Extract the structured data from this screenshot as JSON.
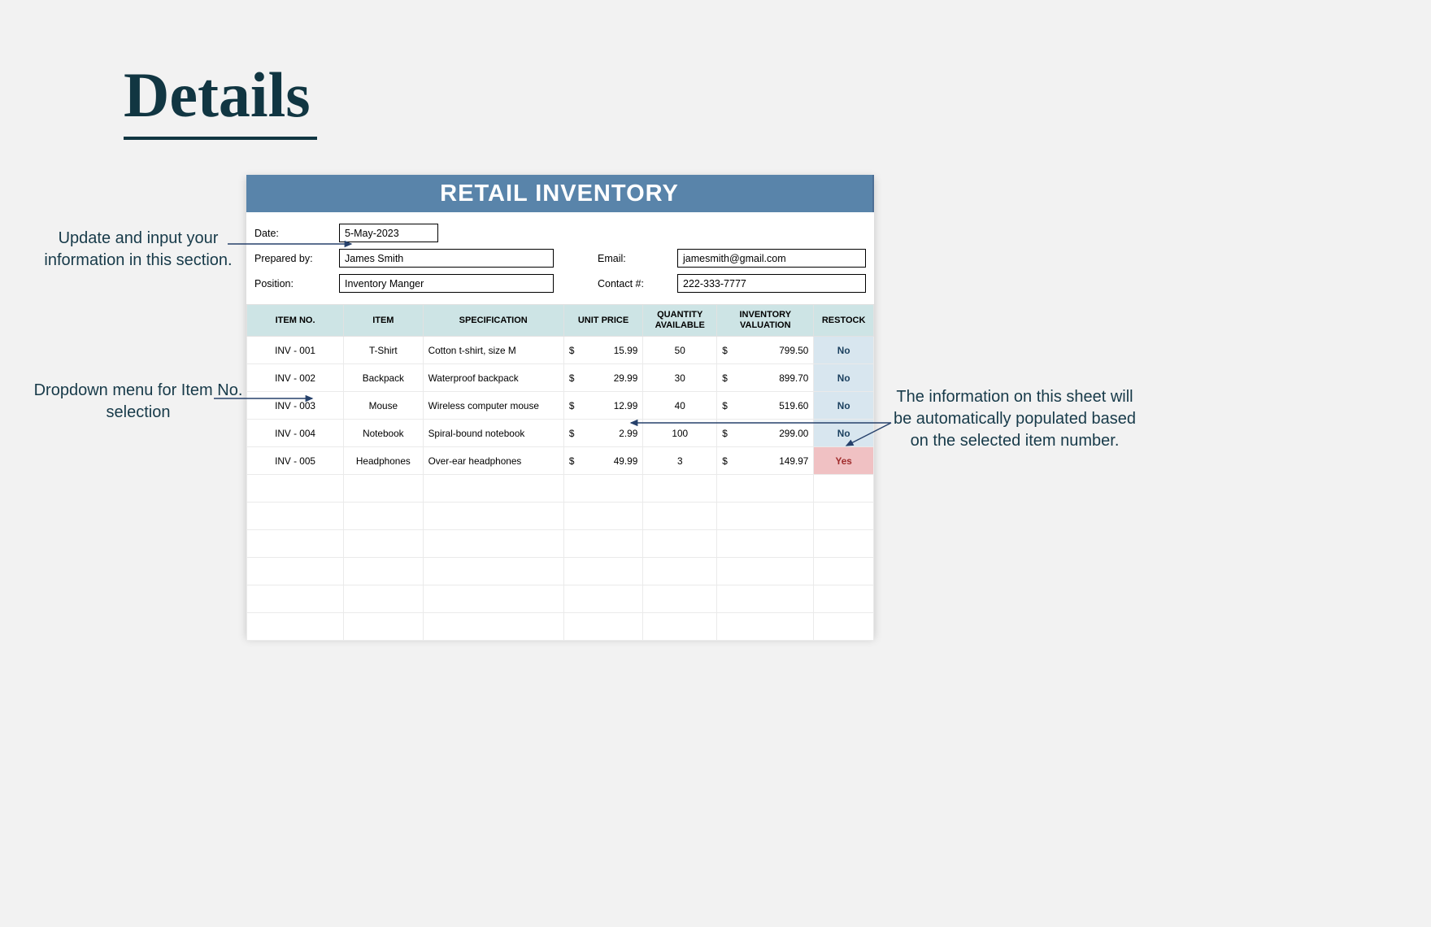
{
  "page": {
    "title": "Details"
  },
  "annotations": {
    "left1": "Update and input your information in this section.",
    "left2": "Dropdown menu for Item No. selection",
    "right": "The information on this sheet will be automatically populated based on the selected item number."
  },
  "sheet": {
    "title": "RETAIL INVENTORY"
  },
  "info": {
    "labels": {
      "date": "Date:",
      "prepared": "Prepared by:",
      "position": "Position:",
      "email": "Email:",
      "contact": "Contact #:"
    },
    "values": {
      "date": "5-May-2023",
      "prepared": "James Smith",
      "position": "Inventory Manger",
      "email": "jamesmith@gmail.com",
      "contact": "222-333-7777"
    }
  },
  "table": {
    "headers": [
      "ITEM NO.",
      "ITEM",
      "SPECIFICATION",
      "UNIT PRICE",
      "QUANTITY AVAILABLE",
      "INVENTORY VALUATION",
      "RESTOCK"
    ],
    "rows": [
      {
        "no": "INV - 001",
        "item": "T-Shirt",
        "spec": "Cotton t-shirt, size M",
        "price": "15.99",
        "qty": "50",
        "val": "799.50",
        "restock": "No"
      },
      {
        "no": "INV - 002",
        "item": "Backpack",
        "spec": "Waterproof backpack",
        "price": "29.99",
        "qty": "30",
        "val": "899.70",
        "restock": "No"
      },
      {
        "no": "INV - 003",
        "item": "Mouse",
        "spec": "Wireless computer mouse",
        "price": "12.99",
        "qty": "40",
        "val": "519.60",
        "restock": "No"
      },
      {
        "no": "INV - 004",
        "item": "Notebook",
        "spec": "Spiral-bound notebook",
        "price": "2.99",
        "qty": "100",
        "val": "299.00",
        "restock": "No"
      },
      {
        "no": "INV - 005",
        "item": "Headphones",
        "spec": "Over-ear headphones",
        "price": "49.99",
        "qty": "3",
        "val": "149.97",
        "restock": "Yes"
      }
    ],
    "currency": "$"
  }
}
